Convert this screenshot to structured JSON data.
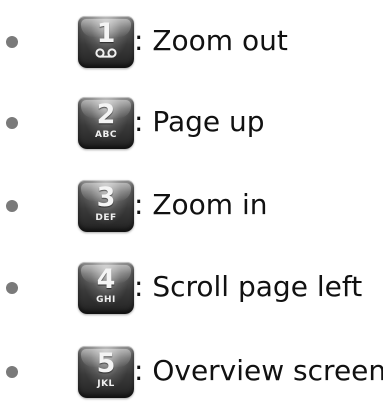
{
  "items": [
    {
      "digit": "1",
      "letters": "",
      "key_icon": "voicemail-icon",
      "text": ": Zoom out"
    },
    {
      "digit": "2",
      "letters": "ABC",
      "text": ": Page up"
    },
    {
      "digit": "3",
      "letters": "DEF",
      "text": ": Zoom in"
    },
    {
      "digit": "4",
      "letters": "GHI",
      "text": ": Scroll page left"
    },
    {
      "digit": "5",
      "letters": "JKL",
      "text": ": Overview screen"
    }
  ],
  "colors": {
    "bullet": "#7a7a7a",
    "key_top": "#8e8e8e",
    "key_bottom": "#222222",
    "key_text": "#f4f4f4",
    "text": "#111111"
  }
}
